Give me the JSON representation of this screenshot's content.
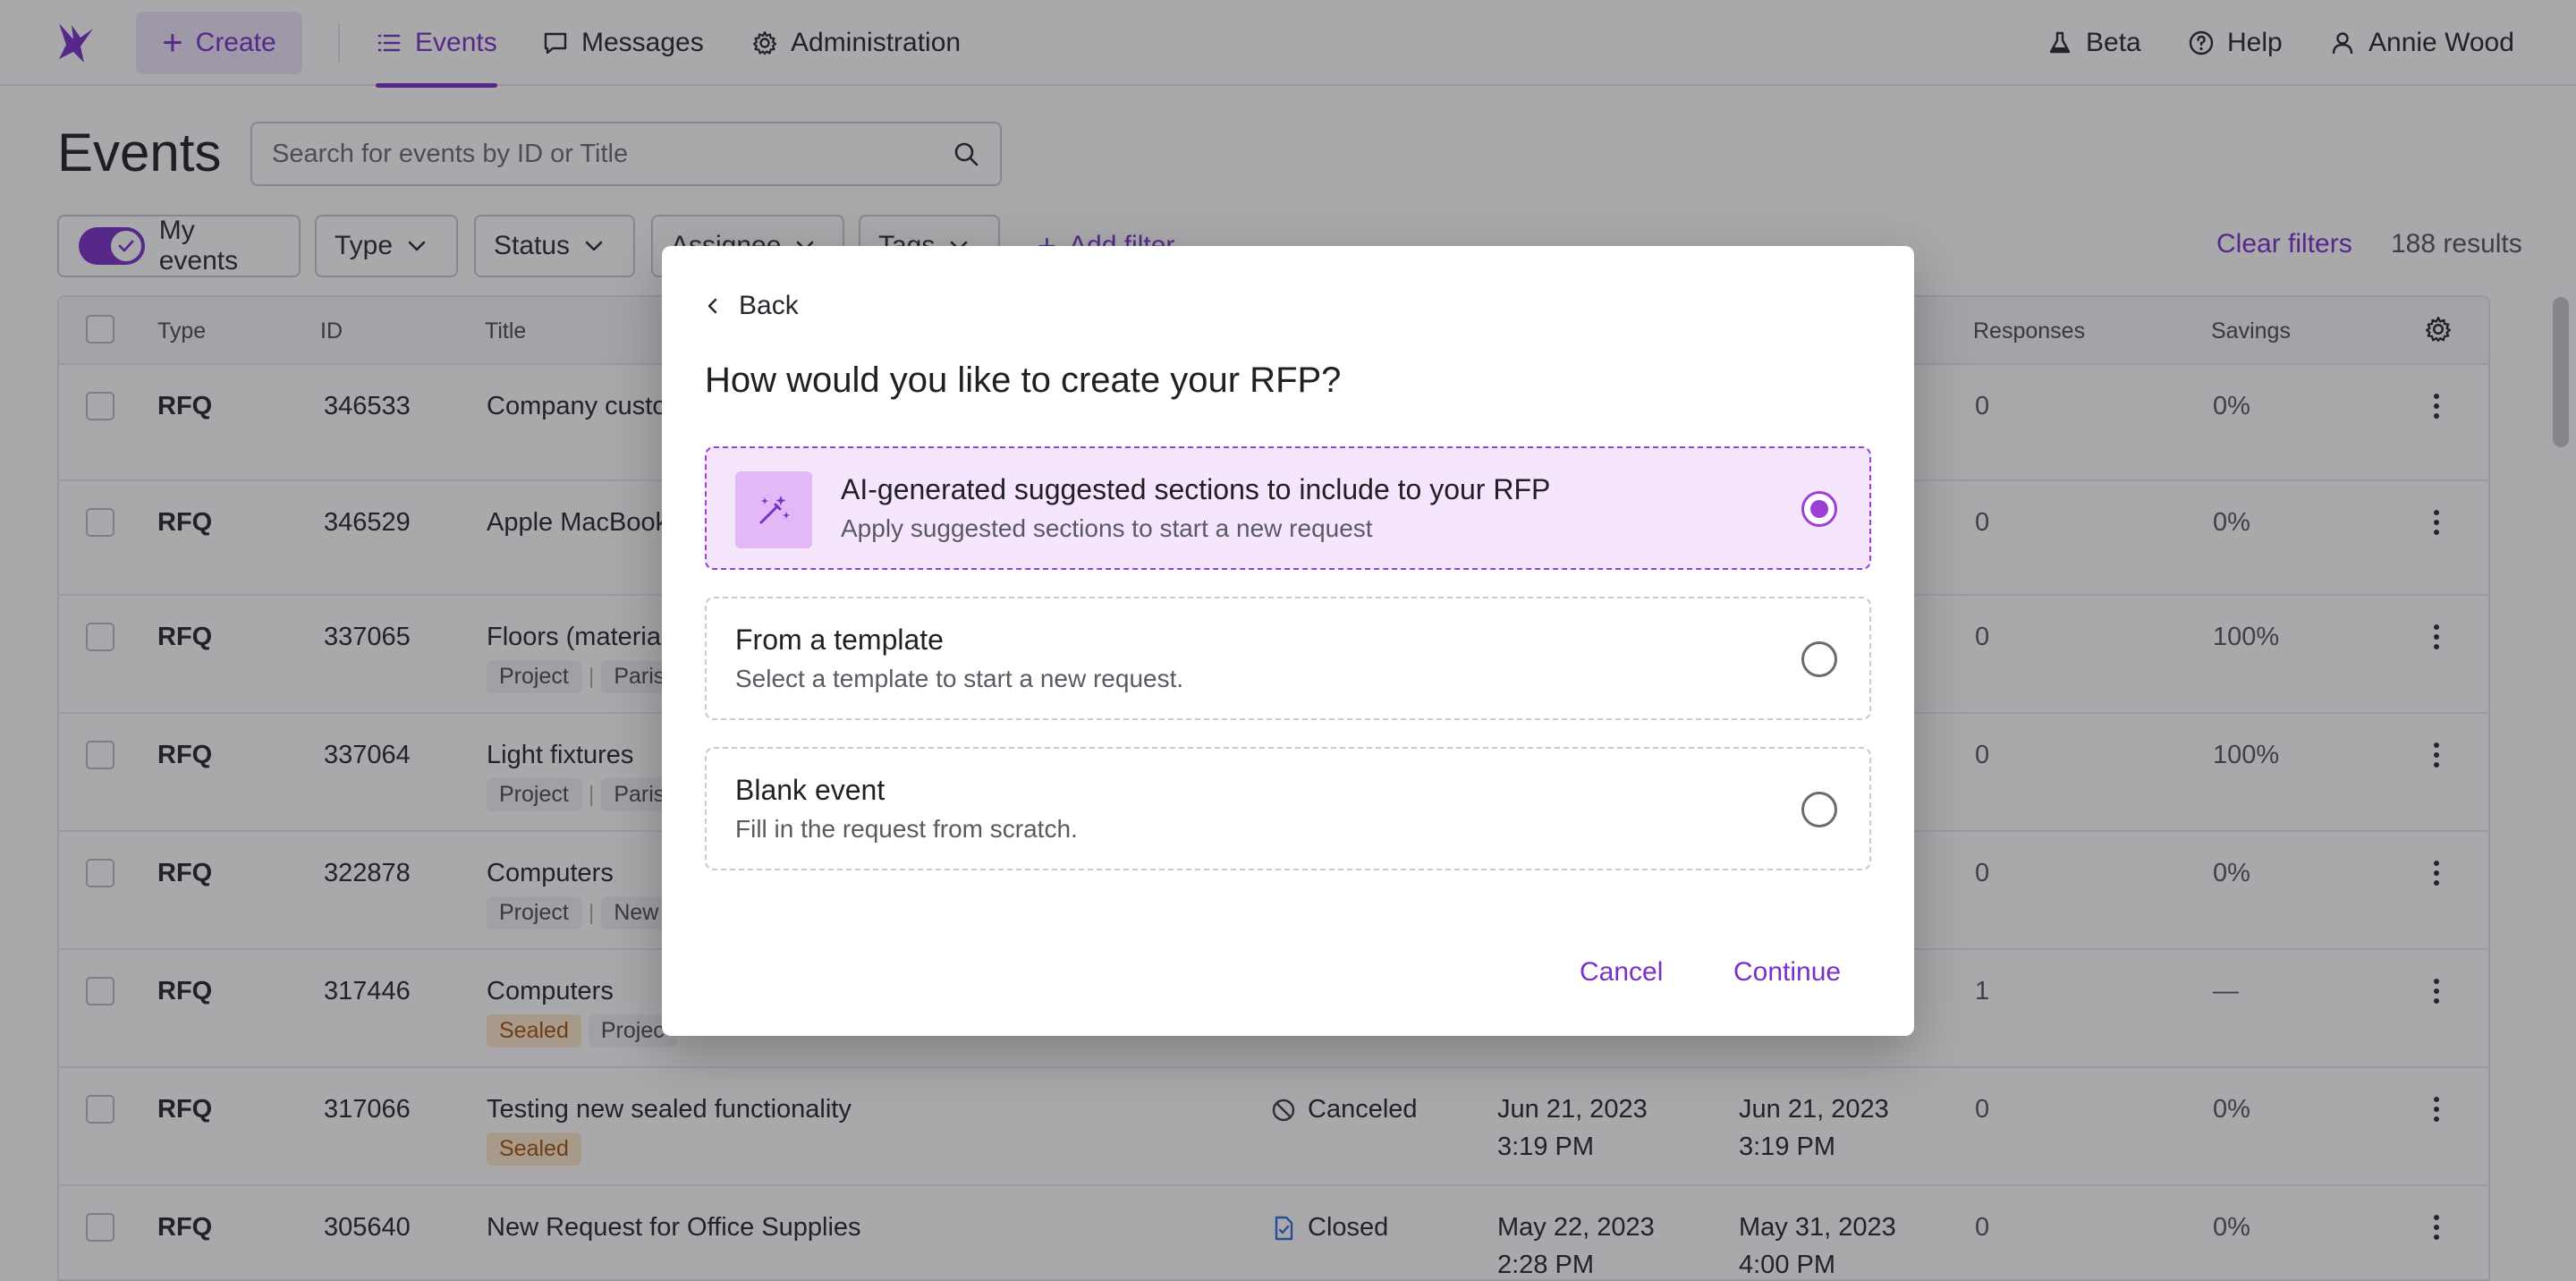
{
  "nav": {
    "create_label": "Create",
    "items": [
      {
        "label": "Events",
        "icon": "list-icon",
        "active": true
      },
      {
        "label": "Messages",
        "icon": "message-icon",
        "active": false
      },
      {
        "label": "Administration",
        "icon": "gear-icon",
        "active": false
      }
    ],
    "right": [
      {
        "label": "Beta",
        "icon": "flask-icon"
      },
      {
        "label": "Help",
        "icon": "help-circle-icon"
      },
      {
        "label": "Annie Wood",
        "icon": "user-icon"
      }
    ]
  },
  "page": {
    "title": "Events",
    "search_placeholder": "Search for events by ID or Title"
  },
  "filters": {
    "my_events": "My events",
    "my_events_on": true,
    "type": "Type",
    "status": "Status",
    "assignee": "Assignee",
    "tags": "Tags",
    "add_filter": "Add filter",
    "clear_filters": "Clear filters",
    "results": "188 results"
  },
  "table": {
    "headers": {
      "type": "Type",
      "id": "ID",
      "title": "Title",
      "responses": "Responses",
      "savings": "Savings"
    },
    "rows": [
      {
        "type": "RFQ",
        "id": "346533",
        "title": "Company custo",
        "tags": [],
        "status": "",
        "d1": "",
        "t1": "",
        "d2": "",
        "t2": "",
        "responses": "0",
        "savings": "0%"
      },
      {
        "type": "RFQ",
        "id": "346529",
        "title": "Apple MacBook",
        "tags": [],
        "status": "",
        "d1": "",
        "t1": "",
        "d2": "",
        "t2": "",
        "responses": "0",
        "savings": "0%"
      },
      {
        "type": "RFQ",
        "id": "337065",
        "title": "Floors (materia",
        "tags": [
          "Project",
          "Paris c"
        ],
        "status": "",
        "d1": "",
        "t1": "",
        "d2": "",
        "t2": "",
        "responses": "0",
        "savings": "100%"
      },
      {
        "type": "RFQ",
        "id": "337064",
        "title": "Light fixtures",
        "tags": [
          "Project",
          "Paris c"
        ],
        "status": "",
        "d1": "",
        "t1": "",
        "d2": "",
        "t2": "",
        "responses": "0",
        "savings": "100%"
      },
      {
        "type": "RFQ",
        "id": "322878",
        "title": "Computers",
        "tags": [
          "Project",
          "New T"
        ],
        "status": "",
        "d1": "",
        "t1": "",
        "d2": "",
        "t2": "",
        "responses": "0",
        "savings": "0%"
      },
      {
        "type": "RFQ",
        "id": "317446",
        "title": "Computers",
        "tags": [
          "Sealed",
          "Projec"
        ],
        "status": "",
        "d1": "",
        "t1": "",
        "d2": "",
        "t2": "",
        "responses": "1",
        "savings": "—"
      },
      {
        "type": "RFQ",
        "id": "317066",
        "title": "Testing new sealed functionality",
        "tags": [
          "Sealed"
        ],
        "status": "Canceled",
        "d1": "Jun 21, 2023",
        "t1": "3:19 PM",
        "d2": "Jun 21, 2023",
        "t2": "3:19 PM",
        "responses": "0",
        "savings": "0%"
      },
      {
        "type": "RFQ",
        "id": "305640",
        "title": "New Request for Office Supplies",
        "tags": [],
        "status": "Closed",
        "d1": "May 22, 2023",
        "t1": "2:28 PM",
        "d2": "May 31, 2023",
        "t2": "4:00 PM",
        "responses": "0",
        "savings": "0%"
      }
    ]
  },
  "modal": {
    "back_label": "Back",
    "title": "How would you like to create your RFP?",
    "options": [
      {
        "title": "AI-generated suggested sections to include to your RFP",
        "desc": "Apply suggested sections to start a new request",
        "selected": true,
        "icon": "magic-wand-icon"
      },
      {
        "title": "From a template",
        "desc": "Select a template to start a new request.",
        "selected": false
      },
      {
        "title": "Blank event",
        "desc": "Fill in the request from scratch.",
        "selected": false
      }
    ],
    "cancel_label": "Cancel",
    "continue_label": "Continue"
  },
  "colors": {
    "accent": "#7a2fc9",
    "selected_bg": "#f6e6fd",
    "selected_border": "#9c3fd6",
    "sealed_bg": "#fde7c8"
  }
}
